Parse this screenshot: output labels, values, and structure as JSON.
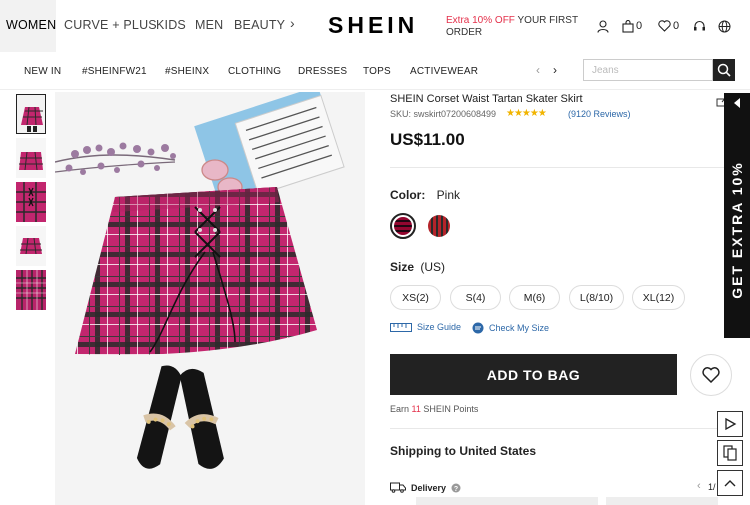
{
  "header": {
    "categories": [
      "WOMEN",
      "CURVE + PLUS",
      "KIDS",
      "MEN",
      "BEAUTY"
    ],
    "logo": "SHEIN",
    "promo_highlight": "Extra 10% OFF",
    "promo_rest": " YOUR FIRST ORDER",
    "cart_count": "0",
    "wishlist_count": "0"
  },
  "nav": {
    "items": [
      "NEW IN",
      "#SHEINFW21",
      "#SHEINX",
      "CLOTHING",
      "DRESSES",
      "TOPS",
      "ACTIVEWEAR"
    ],
    "search_placeholder": "Jeans"
  },
  "product": {
    "title": "SHEIN Corset Waist Tartan Skater Skirt",
    "sku": "SKU: swskirt07200608499",
    "stars": "★★★★★",
    "reviews": "(9120 Reviews)",
    "price": "US$11.00",
    "color_label": "Color:",
    "color_value": "Pink",
    "size_label": "Size",
    "size_unit": "(US)",
    "sizes": [
      "XS(2)",
      "S(4)",
      "M(6)",
      "L(8/10)",
      "XL(12)"
    ],
    "size_guide": "Size Guide",
    "check_size": "Check My Size",
    "add_to_bag": "ADD TO BAG",
    "points_prefix": "Earn",
    "points_value": "11",
    "points_suffix": "SHEIN Points",
    "shipping": "Shipping to United States",
    "delivery": "Delivery",
    "page_indicator": "1/"
  },
  "side_banner": "GET EXTRA 10%",
  "colors": {
    "accent": "#e4304a",
    "link": "#2d68a8",
    "swatch_pink": "#c2266e",
    "swatch_red": "#b4242a"
  }
}
